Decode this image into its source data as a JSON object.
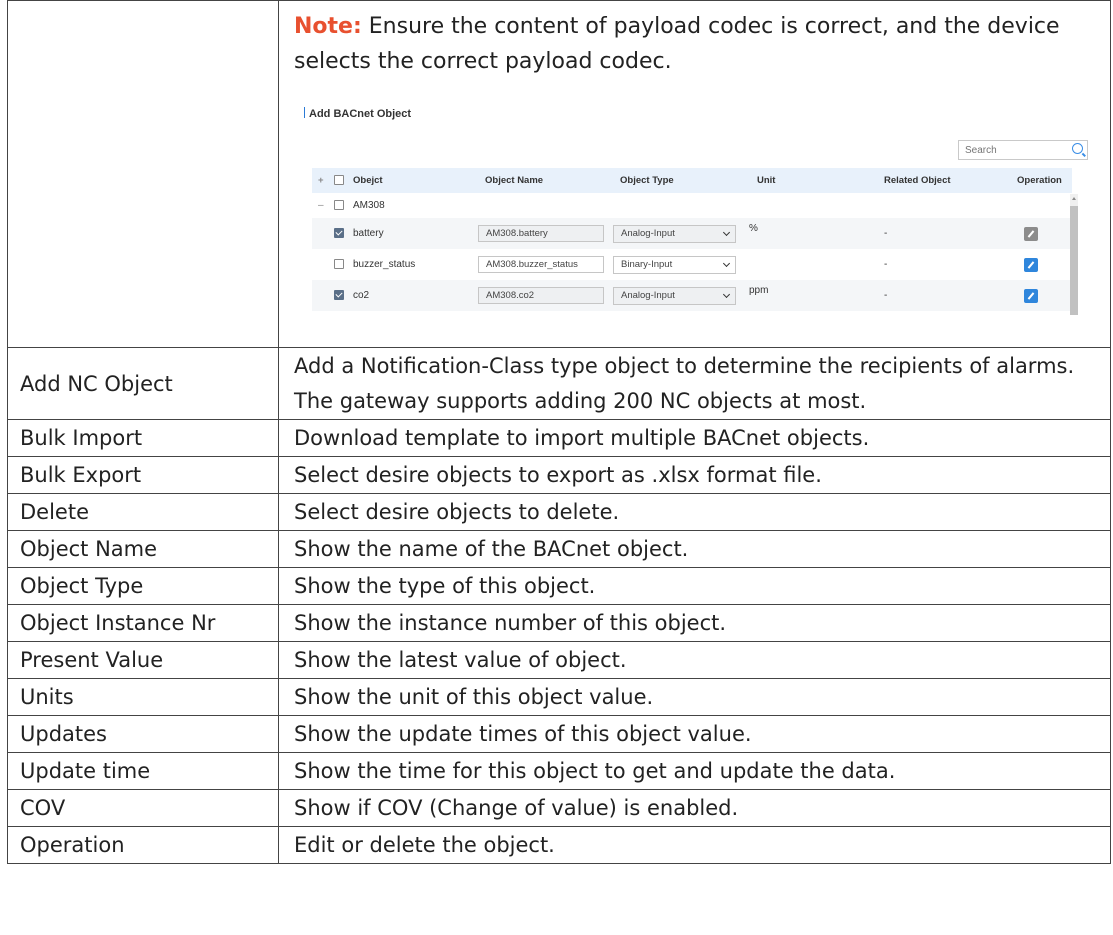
{
  "note": {
    "label": "Note:",
    "text": " Ensure the content of payload codec is correct, and the device selects the correct payload codec."
  },
  "screenshot": {
    "title": "Add BACnet Object",
    "search_placeholder": "Search",
    "headers": {
      "expand": "+",
      "object": "Obejct",
      "object_name": "Object Name",
      "object_type": "Object Type",
      "unit": "Unit",
      "related_object": "Related Object",
      "operation": "Operation"
    },
    "group": {
      "toggle": "–",
      "name": "AM308"
    },
    "rows": [
      {
        "object": "battery",
        "name": "AM308.battery",
        "type": "Analog-Input",
        "unit": "%",
        "related": "-",
        "checked": true
      },
      {
        "object": "buzzer_status",
        "name": "AM308.buzzer_status",
        "type": "Binary-Input",
        "unit": "",
        "related": "-",
        "checked": false
      },
      {
        "object": "co2",
        "name": "AM308.co2",
        "type": "Analog-Input",
        "unit": "ppm",
        "related": "-",
        "checked": true
      }
    ]
  },
  "table": [
    {
      "param": "Add NC Object",
      "desc": "Add a Notification-Class type object to determine the recipients of alarms. The gateway supports adding 200 NC objects at most."
    },
    {
      "param": "Bulk Import",
      "desc": "Download template to import multiple BACnet objects."
    },
    {
      "param": "Bulk Export",
      "desc": "Select desire objects to export as .xlsx format file."
    },
    {
      "param": "Delete",
      "desc": "Select desire objects to delete."
    },
    {
      "param": "Object Name",
      "desc": "Show the name of the BACnet object."
    },
    {
      "param": "Object Type",
      "desc": "Show the type of this object."
    },
    {
      "param": "Object Instance Nr",
      "desc": "Show the instance number of this object."
    },
    {
      "param": "Present Value",
      "desc": "Show the latest value of object."
    },
    {
      "param": "Units",
      "desc": "Show the unit of this object value."
    },
    {
      "param": "Updates",
      "desc": "Show the update times of this object value."
    },
    {
      "param": "Update time",
      "desc": "Show the time for this object to get and update the data."
    },
    {
      "param": "COV",
      "desc": "Show if COV (Change of value) is enabled."
    },
    {
      "param": "Operation",
      "desc": "Edit or delete the object."
    }
  ]
}
